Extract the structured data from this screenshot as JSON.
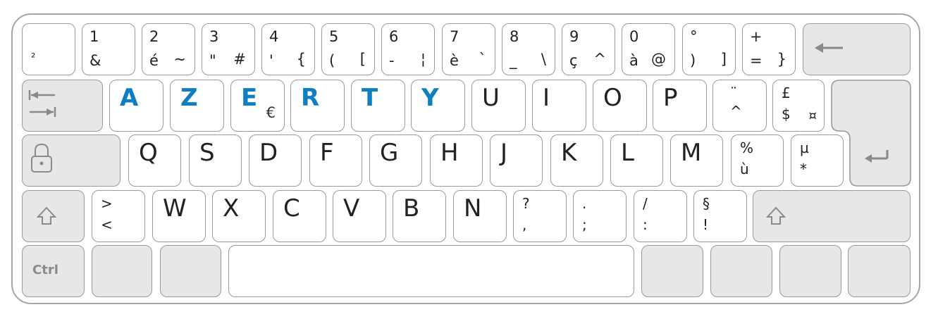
{
  "colors": {
    "accent_blue": "#0f7fc1",
    "grey_key": "#e7e7e7",
    "border": "#9a9a9a"
  },
  "row1": [
    {
      "name": "key-superscript-two",
      "a": "²"
    },
    {
      "name": "key-1",
      "a": "1",
      "b": "&"
    },
    {
      "name": "key-2",
      "a": "2",
      "b": "é",
      "c": "~"
    },
    {
      "name": "key-3",
      "a": "3",
      "b": "\"",
      "c": "#"
    },
    {
      "name": "key-4",
      "a": "4",
      "b": "'",
      "c": "{"
    },
    {
      "name": "key-5",
      "a": "5",
      "b": "(",
      "c": "["
    },
    {
      "name": "key-6",
      "a": "6",
      "b": "-",
      "c": "¦"
    },
    {
      "name": "key-7",
      "a": "7",
      "b": "è",
      "c": "`"
    },
    {
      "name": "key-8",
      "a": "8",
      "b": "_",
      "c": "\\"
    },
    {
      "name": "key-9",
      "a": "9",
      "b": "ç",
      "c": "^"
    },
    {
      "name": "key-0",
      "a": "0",
      "b": "à",
      "c": "@"
    },
    {
      "name": "key-degree",
      "a": "°",
      "b": ")",
      "c": "]"
    },
    {
      "name": "key-plus",
      "a": "+",
      "b": "=",
      "c": "}"
    }
  ],
  "row2": [
    {
      "name": "key-a",
      "m": "A",
      "blue": true
    },
    {
      "name": "key-z",
      "m": "Z",
      "blue": true
    },
    {
      "name": "key-e",
      "m": "E",
      "blue": true,
      "e2": "€"
    },
    {
      "name": "key-r",
      "m": "R",
      "blue": true
    },
    {
      "name": "key-t",
      "m": "T",
      "blue": true
    },
    {
      "name": "key-y",
      "m": "Y",
      "blue": true
    },
    {
      "name": "key-u",
      "m": "U"
    },
    {
      "name": "key-i",
      "m": "I"
    },
    {
      "name": "key-o",
      "m": "O"
    },
    {
      "name": "key-p",
      "m": "P"
    },
    {
      "name": "key-circumflex",
      "u": "¨",
      "l": "^"
    },
    {
      "name": "key-pound",
      "u": "£",
      "l": "$",
      "c": "¤"
    }
  ],
  "row3": [
    {
      "name": "key-q",
      "m": "Q"
    },
    {
      "name": "key-s",
      "m": "S"
    },
    {
      "name": "key-d",
      "m": "D"
    },
    {
      "name": "key-f",
      "m": "F"
    },
    {
      "name": "key-g",
      "m": "G"
    },
    {
      "name": "key-h",
      "m": "H"
    },
    {
      "name": "key-j",
      "m": "J"
    },
    {
      "name": "key-k",
      "m": "K"
    },
    {
      "name": "key-l",
      "m": "L"
    },
    {
      "name": "key-m",
      "m": "M"
    },
    {
      "name": "key-percent",
      "u": "%",
      "l": "ù"
    },
    {
      "name": "key-mu",
      "u": "µ",
      "l": "*"
    }
  ],
  "row4": [
    {
      "name": "key-angle-brackets",
      "u": ">",
      "l": "<"
    },
    {
      "name": "key-w",
      "m": "W"
    },
    {
      "name": "key-x",
      "m": "X"
    },
    {
      "name": "key-c",
      "m": "C"
    },
    {
      "name": "key-v",
      "m": "V"
    },
    {
      "name": "key-b",
      "m": "B"
    },
    {
      "name": "key-n",
      "m": "N"
    },
    {
      "name": "key-question",
      "u": "?",
      "l": ","
    },
    {
      "name": "key-period",
      "u": ".",
      "l": ";"
    },
    {
      "name": "key-slash",
      "u": "/",
      "l": ":"
    },
    {
      "name": "key-section",
      "u": "§",
      "l": "!"
    }
  ],
  "ctrl_label": "Ctrl"
}
